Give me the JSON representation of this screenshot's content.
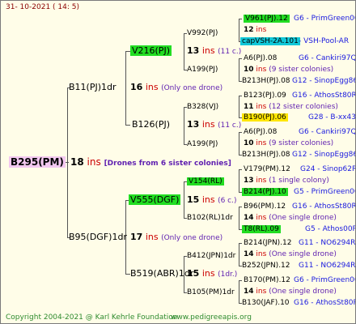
{
  "header": {
    "date": "31- 10-2021 ( 14: 5)"
  },
  "colors": {
    "green": "#22dd22",
    "cyan": "#10c8d8",
    "yellow": "#ffe600",
    "pink": "#f3c8f0",
    "ins": "#cc0000",
    "note": "#5f1fb0",
    "index": "#1a1adf",
    "footer": "#2e8b2e"
  },
  "root": {
    "name": "B295(PM)",
    "num": "18",
    "ins": "ins",
    "note": "[Drones from 6 sister colonies]"
  },
  "gen1": [
    {
      "name": "B11(PJ)1dr",
      "num": "16",
      "ins": "ins",
      "note": "(Only one drone)"
    },
    {
      "name": "B95(DGF)1dr",
      "num": "17",
      "ins": "ins",
      "note": "(Only one drone)"
    }
  ],
  "gen2": [
    {
      "name": "V216(PJ)",
      "num": "13",
      "ins": "ins",
      "note": "(11 c.)"
    },
    {
      "name": "B126(PJ)",
      "num": "13",
      "ins": "ins",
      "note": "(11 c.)"
    },
    {
      "name": "V555(DGF)",
      "num": "15",
      "ins": "ins",
      "note": "(6 c.)"
    },
    {
      "name": "B519(ABR)1dr",
      "num": "15",
      "ins": "ins",
      "note": "(1dr.)"
    }
  ],
  "gen3": [
    {
      "name": "V992(PJ)",
      "num": "12",
      "ins": "ins",
      "note": ""
    },
    {
      "name": "A199(PJ)",
      "num": "",
      "ins": "",
      "note": ""
    },
    {
      "name": "B328(VJ)",
      "num": "11",
      "ins": "ins",
      "note": "(12 sister colonies)"
    },
    {
      "name": "A199(PJ)",
      "num": "",
      "ins": "",
      "note": ""
    },
    {
      "name": "V154(RL)",
      "num": "13",
      "ins": "ins",
      "note": "(1 single colony)"
    },
    {
      "name": "B102(RL)1dr",
      "num": "14",
      "ins": "ins",
      "note": "(One single drone)"
    },
    {
      "name": "B412(JPN)1dr",
      "num": "14",
      "ins": "ins",
      "note": "(One single drone)"
    },
    {
      "name": "B105(PM)1dr",
      "num": "14",
      "ins": "ins",
      "note": "(One single drone)"
    }
  ],
  "gen4": [
    {
      "name": "V961(PJ).12",
      "idx": "G6 - PrimGreen00"
    },
    {
      "name": "capVSH-2A.101",
      "idx": "- VSH-Pool-AR"
    },
    {
      "name": "A6(PJ).08",
      "idx": "G6 - Cankiri97Q"
    },
    {
      "name": "B213H(PJ).08",
      "idx": "G12 - SinopEgg86R"
    },
    {
      "name": "B123(PJ).09",
      "idx": "G16 - AthosSt80R"
    },
    {
      "name": "B190(PJ).06",
      "idx": "G28 - B-xx43"
    },
    {
      "name": "A6(PJ).08",
      "idx": "G6 - Cankiri97Q"
    },
    {
      "name": "B213H(PJ).08",
      "idx": "G12 - SinopEgg86R"
    },
    {
      "name": "V179(PM).12",
      "idx": "G24 - Sinop62R"
    },
    {
      "name": "B214(PJ).10",
      "idx": "G5 - PrimGreen00"
    },
    {
      "name": "B96(PM).12",
      "idx": "G16 - AthosSt80R"
    },
    {
      "name": "T8(RL).09",
      "idx": "G5 - Athos00R"
    },
    {
      "name": "B214(JPN).12",
      "idx": "G11 - NO6294R"
    },
    {
      "name": "B252(JPN).12",
      "idx": "G11 - NO6294R"
    },
    {
      "name": "B170(PM).12",
      "idx": "G6 - PrimGreen00"
    },
    {
      "name": "B130(JAF).10",
      "idx": "G16 - AthosSt80R"
    }
  ],
  "gen3_sub": [
    {
      "num": "10",
      "ins": "ins",
      "note": "(9 sister colonies)"
    },
    {
      "num": "10",
      "ins": "ins",
      "note": "(9 sister colonies)"
    }
  ],
  "footer": {
    "copyright": "Copyright 2004-2021 @ Karl Kehrle Foundation",
    "site": "www.pedigreeapis.org"
  }
}
